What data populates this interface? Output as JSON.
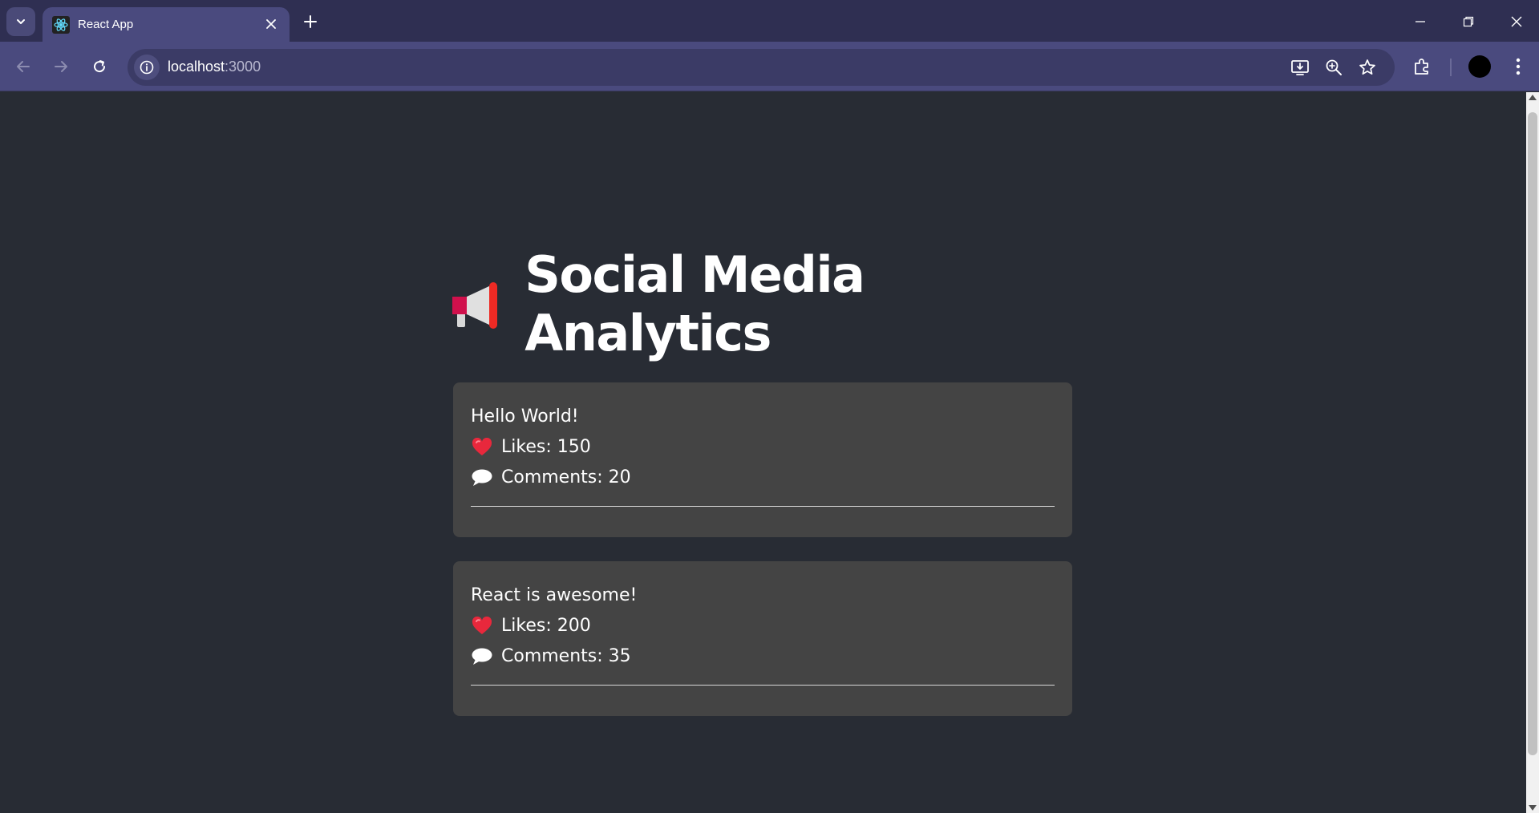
{
  "browser": {
    "tab_title": "React App",
    "url_host": "localhost",
    "url_port": ":3000",
    "icons": [
      "tab-search-icon",
      "react-logo-icon",
      "close-icon",
      "plus-icon",
      "minimize-icon",
      "restore-icon",
      "close-window-icon",
      "back-icon",
      "forward-icon",
      "reload-icon",
      "site-info-icon",
      "install-app-icon",
      "zoom-icon",
      "bookmark-star-icon",
      "extensions-icon",
      "profile-avatar",
      "more-menu-icon"
    ]
  },
  "page": {
    "heading_emoji": "📢",
    "heading": "Social Media Analytics",
    "posts": [
      {
        "text": "Hello World!",
        "likes": "Likes: 150",
        "comments": "Comments: 20"
      },
      {
        "text": "React is awesome!",
        "likes": "Likes: 200",
        "comments": "Comments: 35"
      }
    ]
  },
  "colors": {
    "page_background": "#282c34",
    "card_background": "#444444",
    "browser_frame": "#4a4a7e",
    "tab_strip": "#2f2f52"
  }
}
